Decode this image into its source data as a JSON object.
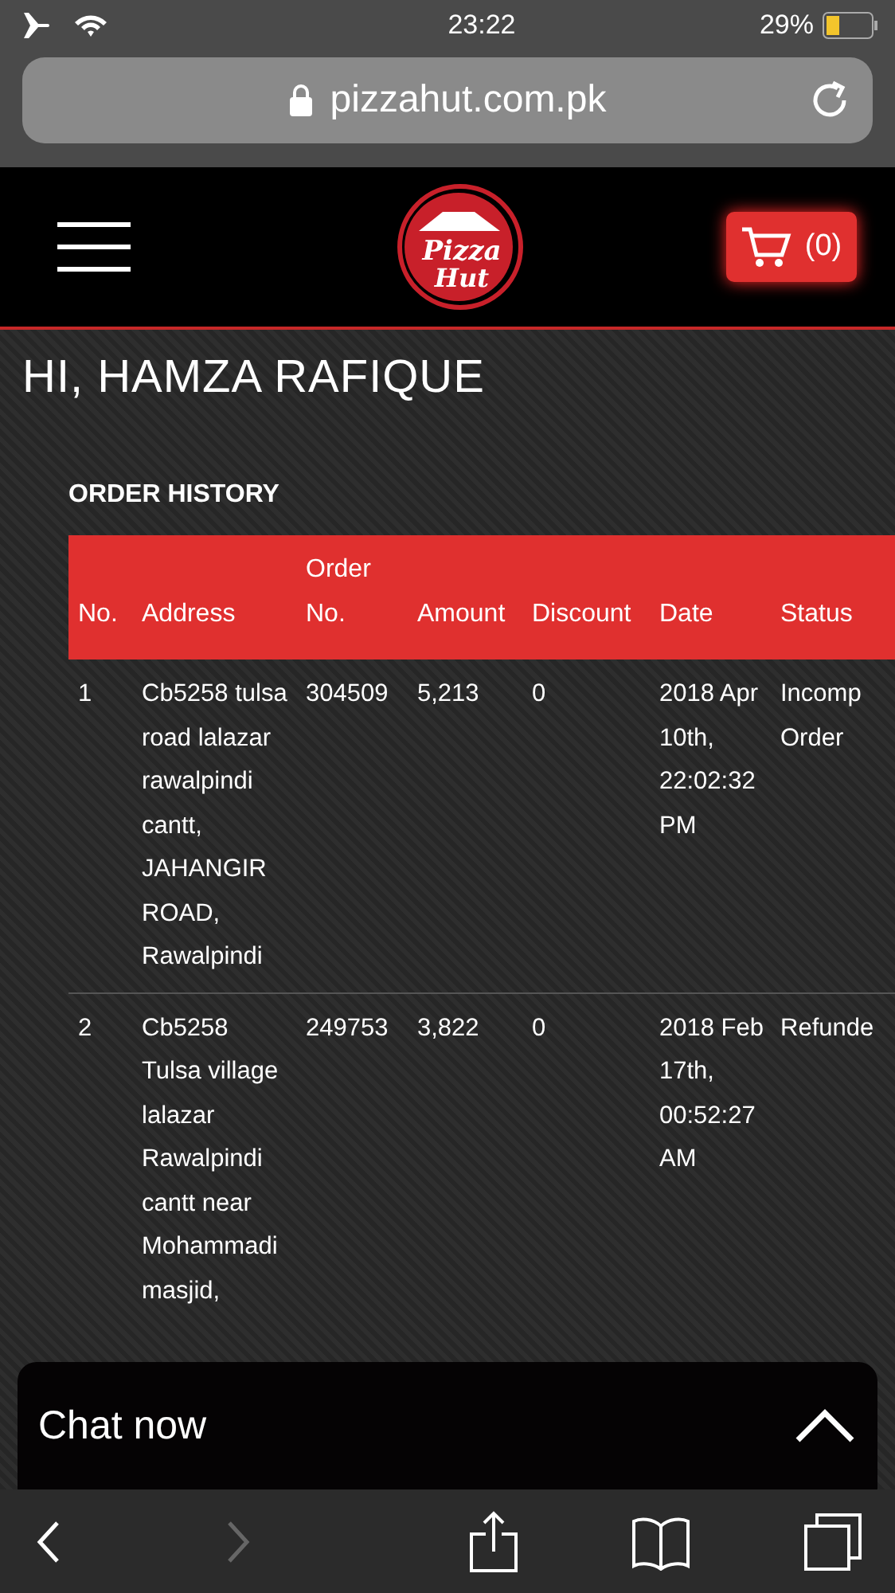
{
  "status_bar": {
    "time": "23:22",
    "battery": "29%"
  },
  "address_bar": {
    "url": "pizzahut.com.pk"
  },
  "header": {
    "logo": [
      "Pizza",
      "Hut"
    ],
    "cart_count": "(0)"
  },
  "greeting": "HI, HAMZA RAFIQUE",
  "order_history": {
    "title": "ORDER HISTORY",
    "columns": [
      {
        "lines": [
          "No."
        ]
      },
      {
        "lines": [
          "Address"
        ]
      },
      {
        "lines": [
          "Order",
          "No."
        ]
      },
      {
        "lines": [
          "Amount"
        ]
      },
      {
        "lines": [
          "Discount"
        ]
      },
      {
        "lines": [
          "Date"
        ]
      },
      {
        "lines": [
          "Status"
        ]
      }
    ],
    "rows": [
      {
        "no": "1",
        "address": "Cb5258 tulsa road lalazar rawalpindi cantt, JAHANGIR ROAD, Rawalpindi",
        "order_no": "304509",
        "amount": "5,213",
        "discount": "0",
        "date": "2018 Apr 10th, 22:02:32 PM",
        "status": "Incomp Order"
      },
      {
        "no": "2",
        "address": "Cb5258 Tulsa village lalazar Rawalpindi cantt near Mohammadi masjid,",
        "order_no": "249753",
        "amount": "3,822",
        "discount": "0",
        "date": "2018 Feb 17th, 00:52:27 AM",
        "status": "Refunde"
      }
    ]
  },
  "chat": {
    "label": "Chat now"
  },
  "toolbar": [
    {
      "kind": "back",
      "disabled": false
    },
    {
      "kind": "forward",
      "disabled": true
    },
    {
      "kind": "share",
      "disabled": false
    },
    {
      "kind": "bookmarks",
      "disabled": false
    },
    {
      "kind": "tabs",
      "disabled": false
    }
  ]
}
